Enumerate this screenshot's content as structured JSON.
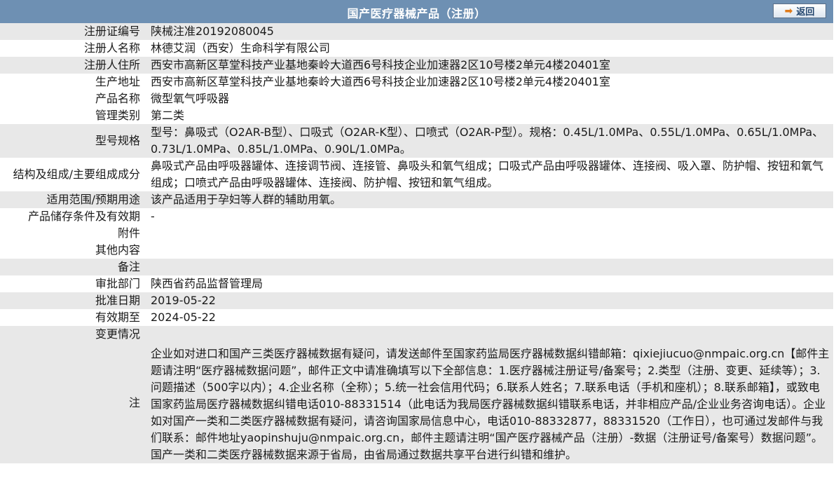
{
  "header": {
    "title": "国产医疗器械产品（注册）",
    "back_label": "返回"
  },
  "rows": [
    {
      "label": "注册证编号",
      "value": "陕械注准20192080045"
    },
    {
      "label": "注册人名称",
      "value": "林德艾润（西安）生命科学有限公司"
    },
    {
      "label": "注册人住所",
      "value": "西安市高新区草堂科技产业基地秦岭大道西6号科技企业加速器2区10号楼2单元4楼20401室"
    },
    {
      "label": "生产地址",
      "value": "西安市高新区草堂科技产业基地秦岭大道西6号科技企业加速器2区10号楼2单元4楼20401室"
    },
    {
      "label": "产品名称",
      "value": "微型氧气呼吸器"
    },
    {
      "label": "管理类别",
      "value": "第二类"
    },
    {
      "label": "型号规格",
      "value": "型号：鼻吸式（O2AR-B型）、口吸式（O2AR-K型）、口喷式（O2AR-P型）。规格：0.45L/1.0MPa、0.55L/1.0MPa、0.65L/1.0MPa、0.73L/1.0MPa、0.85L/1.0MPa、0.90L/1.0MPa。"
    },
    {
      "label": "结构及组成/主要组成成分",
      "value": "鼻吸式产品由呼吸器罐体、连接调节阀、连接管、鼻吸头和氧气组成；口吸式产品由呼吸器罐体、连接阀、吸入罩、防护帽、按钮和氧气组成；口喷式产品由呼吸器罐体、连接阀、防护帽、按钮和氧气组成。"
    },
    {
      "label": "适用范围/预期用途",
      "value": "该产品适用于孕妇等人群的辅助用氧。"
    },
    {
      "label": "产品储存条件及有效期",
      "value": "-"
    },
    {
      "label": "附件",
      "value": ""
    },
    {
      "label": "其他内容",
      "value": ""
    },
    {
      "label": "备注",
      "value": ""
    },
    {
      "label": "审批部门",
      "value": "陕西省药品监督管理局"
    },
    {
      "label": "批准日期",
      "value": "2019-05-22"
    },
    {
      "label": "有效期至",
      "value": "2024-05-22"
    },
    {
      "label": "变更情况",
      "value": ""
    }
  ],
  "note": {
    "label": "注",
    "text": "企业如对进口和国产三类医疗器械数据有疑问，请发送邮件至国家药监局医疗器械数据纠错邮箱：qixiejiucuo@nmpaic.org.cn【邮件主题请注明“医疗器械数据问题”，邮件正文中请准确填写以下全部信息：1.医疗器械注册证号/备案号；2.类型（注册、变更、延续等）；3.问题描述（500字以内）；4.企业名称（全称）；5.统一社会信用代码；6.联系人姓名；7.联系电话（手机和座机）；8.联系邮箱】，或致电国家药监局医疗器械数据纠错电话010-88331514（此电话为我局医疗器械数据纠错联系电话，并非相应产品/企业业务咨询电话）。企业如对国产一类和二类医疗器械数据有疑问，请咨询国家局信息中心，电话010-88332877，88331520（工作日），也可通过发邮件与我们联系：邮件地址yaopinshuju@nmpaic.org.cn，邮件主题请注明“国产医疗器械产品（注册）-数据（注册证号/备案号）数据问题”。国产一类和二类医疗器械数据来源于省局，由省局通过数据共享平台进行纠错和维护。"
  },
  "colors": {
    "header_bg": "#6e90b3",
    "alt_row_bg": "#e8e8e8",
    "back_arrow": "#e07b1a"
  }
}
